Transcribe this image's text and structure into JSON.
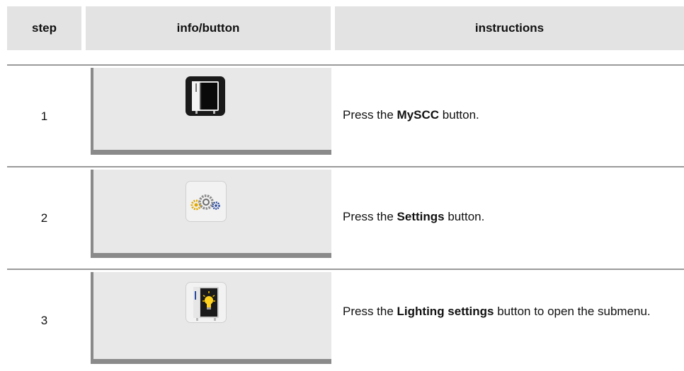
{
  "header": {
    "step": "step",
    "info": "info/button",
    "instructions": "instructions"
  },
  "rows": [
    {
      "step": "1",
      "icon": "myscc-button-icon",
      "pre": "Press the ",
      "bold": "MySCC",
      "post": " button."
    },
    {
      "step": "2",
      "icon": "settings-gears-icon",
      "pre": "Press the ",
      "bold": "Settings",
      "post": " button."
    },
    {
      "step": "3",
      "icon": "lighting-settings-icon",
      "pre": "Press the ",
      "bold": "Lighting settings",
      "post": " button to open the submenu."
    }
  ]
}
